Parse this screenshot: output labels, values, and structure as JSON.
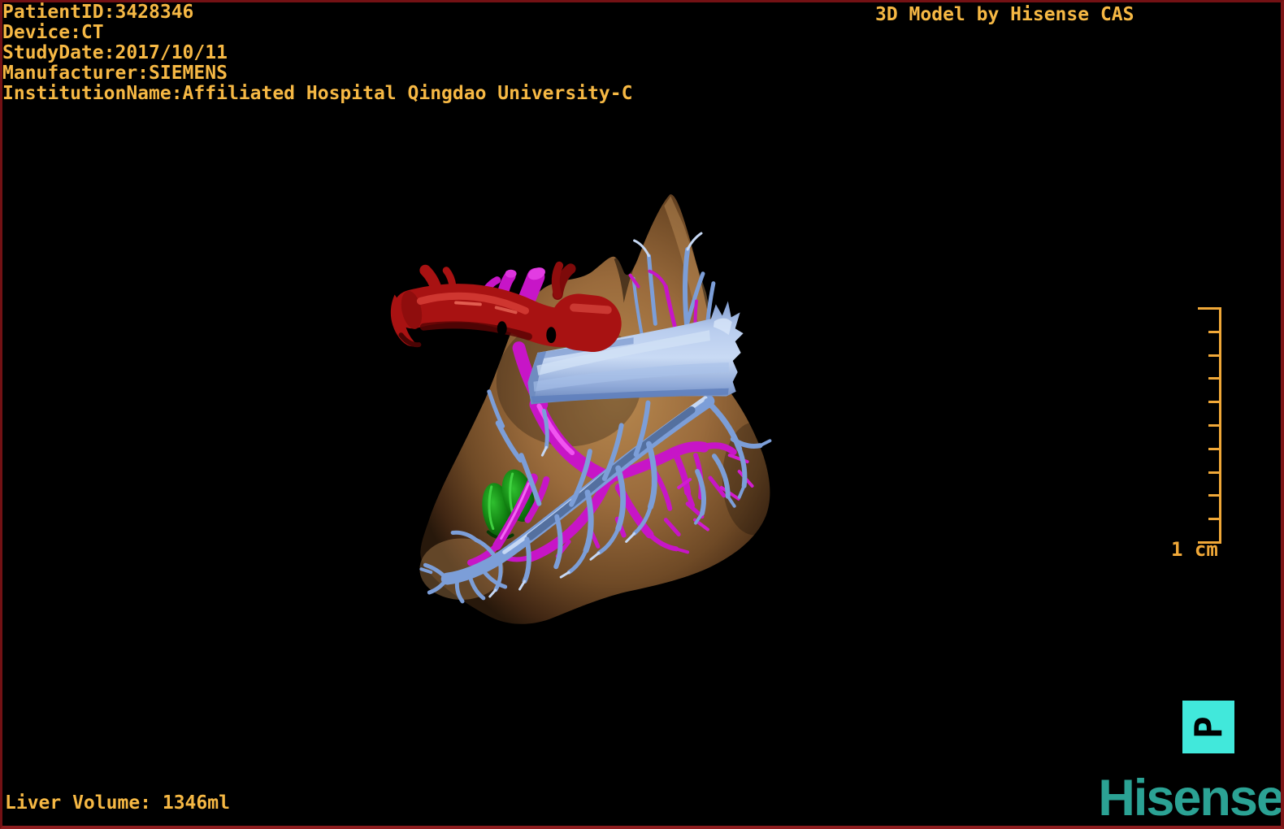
{
  "header": {
    "patient_info": [
      "PatientID:3428346",
      "Device:CT",
      "StudyDate:2017/10/11",
      "Manufacturer:SIEMENS",
      "InstitutionName:Affiliated Hospital Qingdao University-C"
    ],
    "watermark": "3D Model by Hisense CAS"
  },
  "footer": {
    "liver_volume": "Liver Volume: 1346ml",
    "brand": "Hisense"
  },
  "scale_bar": {
    "label": "1 cm",
    "tick_count": 11,
    "color": "#f0a838"
  },
  "orientation_marker": {
    "letter": "P",
    "bg_color": "#41e8db"
  },
  "colors": {
    "info_text": "#f6b844",
    "brand_teal": "#2ba294",
    "liver": "#96683c",
    "hepatic_artery": "#a81212",
    "portal_vein": "#c715c7",
    "hepatic_vein": "#7c9ed8",
    "ivc": "#a9c2ea",
    "gallbladder": "#118011"
  },
  "model": {
    "structures": [
      {
        "name": "liver",
        "color": "#96683c"
      },
      {
        "name": "hepatic-artery",
        "color": "#a81212"
      },
      {
        "name": "portal-vein",
        "color": "#c715c7"
      },
      {
        "name": "hepatic-veins",
        "color": "#7c9ed8"
      },
      {
        "name": "inferior-vena-cava",
        "color": "#a9c2ea"
      },
      {
        "name": "gallbladder",
        "color": "#118011"
      }
    ]
  }
}
